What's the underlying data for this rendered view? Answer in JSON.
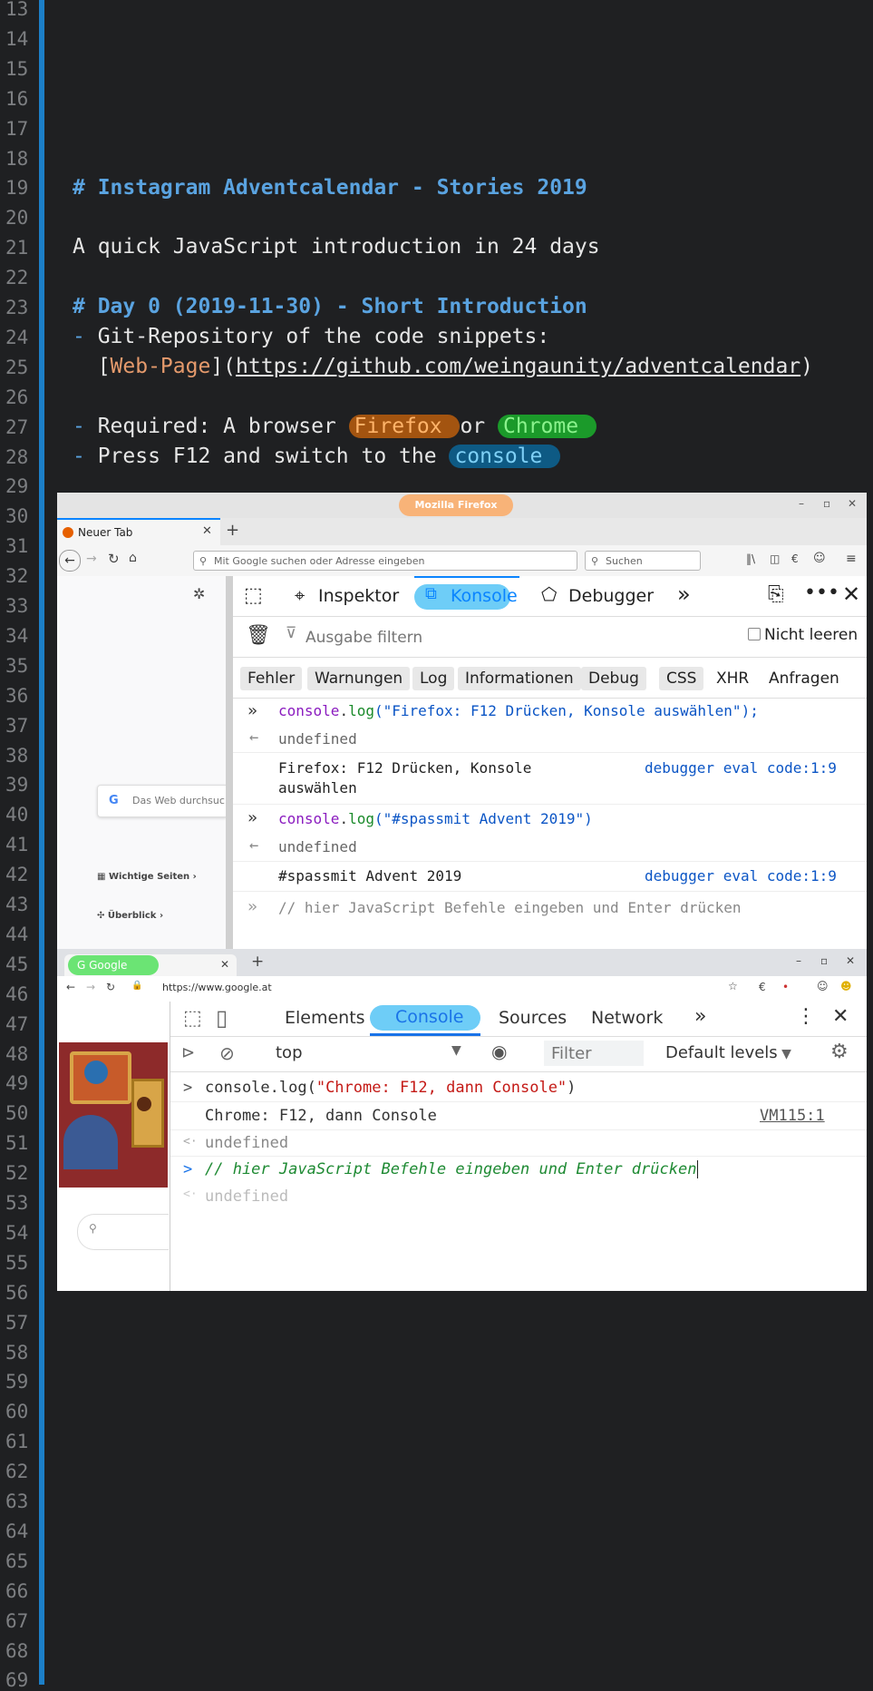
{
  "editor": {
    "line_numbers": [
      "13",
      "14",
      "15",
      "16",
      "17",
      "18",
      "19",
      "20",
      "21",
      "22",
      "23",
      "24",
      "25",
      "26",
      "27",
      "28",
      "29",
      "30",
      "31",
      "32",
      "33",
      "34",
      "35",
      "36",
      "37",
      "38",
      "39",
      "40",
      "41",
      "42",
      "43",
      "44",
      "45",
      "46",
      "47",
      "48",
      "49",
      "50",
      "51",
      "52",
      "53",
      "54",
      "55",
      "56",
      "57",
      "58",
      "59",
      "60",
      "61",
      "62",
      "63",
      "64",
      "65",
      "66",
      "67",
      "68",
      "69"
    ],
    "lines": {
      "l19": "# Instagram Adventcalendar - Stories 2019",
      "l21": "A quick JavaScript introduction in 24 days",
      "l23": "# Day 0 (2019-11-30) - Short Introduction",
      "l24_dash": "-",
      "l24_text": " Git-Repository of the code snippets:",
      "l25_open": "  [",
      "l25_link": "Web-Page",
      "l25_mid": "](",
      "l25_url": "https://github.com/weingaunity/adventcalendar",
      "l25_close": ")",
      "l27_dash": "-",
      "l27_text": " Required: A browser ",
      "l27_ff": "Firefox ",
      "l27_or": "or ",
      "l27_ch": "Chrome ",
      "l28_dash": "-",
      "l28_text": " Press F12 and switch to the ",
      "l28_co": "console "
    }
  },
  "firefox": {
    "window_title": "Mozilla Firefox",
    "tab_label": "Neuer Tab",
    "url_placeholder": "Mit Google suchen oder Adresse eingeben",
    "search_placeholder": "Suchen",
    "newtab_search": "Das Web durchsuc",
    "wichtige": "Wichtige Seiten",
    "ueberblick": "Überblick",
    "devtools": {
      "inspector": "Inspektor",
      "console": "Konsole",
      "debugger": "Debugger",
      "filter_placeholder": "Ausgabe filtern",
      "persist": "Nicht leeren",
      "levels": [
        "Fehler",
        "Warnungen",
        "Log",
        "Informationen",
        "Debug"
      ],
      "css": "CSS",
      "xhr": "XHR",
      "requests": "Anfragen",
      "entries": {
        "in1_fn": "console",
        "in1_dot": ".",
        "in1_log": "log",
        "in1_str": "(\"Firefox: F12 Drücken, Konsole auswählen\");",
        "undef1": "undefined",
        "out1_line1": "Firefox: F12 Drücken, Konsole",
        "out1_line2": "auswählen",
        "src1": "debugger eval code:1:9",
        "in2_fn": "console",
        "in2_dot": ".",
        "in2_log": "log",
        "in2_str": "(\"#spassmit Advent 2019\")",
        "undef2": "undefined",
        "out2": "#spassmit Advent 2019",
        "src2": "debugger eval code:1:9",
        "prompt": "// hier JavaScript Befehle eingeben und Enter drücken"
      }
    }
  },
  "chrome": {
    "tab_label": "Google",
    "url": "https://www.google.at",
    "devtools": {
      "tabs": [
        "Elements",
        "Console",
        "Sources",
        "Network"
      ],
      "context": "top",
      "filter_placeholder": "Filter",
      "levels": "Default levels",
      "entries": {
        "in1_a": "console.log(",
        "in1_str": "\"Chrome: F12, dann Console\"",
        "in1_b": ")",
        "out1": "Chrome: F12, dann Console",
        "src1": "VM115:1",
        "undef1": "undefined",
        "prompt": "// hier JavaScript Befehle eingeben und Enter drücken",
        "undef2": "undefined"
      }
    }
  },
  "colors": {
    "background": "#1f2022",
    "gutter_accent": "#1c7fc8",
    "heading": "#5aa3e0"
  }
}
